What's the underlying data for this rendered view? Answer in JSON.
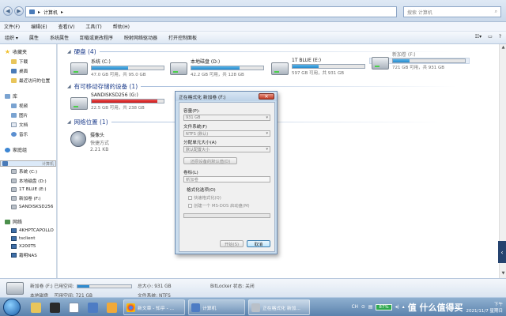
{
  "address": {
    "path": "计算机",
    "search_placeholder": "搜索 计算机"
  },
  "menu": {
    "items": [
      "文件(F)",
      "编辑(E)",
      "查看(V)",
      "工具(T)",
      "帮助(H)"
    ]
  },
  "commands": {
    "items": [
      "组织 ▾",
      "属性",
      "系统属性",
      "卸载或更改程序",
      "映射网络驱动器",
      "打开控制面板"
    ]
  },
  "nav": {
    "favorites": {
      "title": "收藏夹",
      "items": [
        "下载",
        "桌面",
        "最近访问的位置"
      ]
    },
    "library": {
      "title": "库",
      "items": [
        "视频",
        "图片",
        "文档",
        "音乐"
      ]
    },
    "homegroup": {
      "title": "家庭组"
    },
    "computer": {
      "title": "计算机",
      "items": [
        "系统 (C:)",
        "本地磁盘 (D:)",
        "1T BLUE (E:)",
        "新加卷 (F:)",
        "SANDISKSD256"
      ]
    },
    "network": {
      "title": "网络",
      "items": [
        "4KHPTCAPOLLO",
        "tsclient",
        "X200T5",
        "霜明NAS"
      ]
    }
  },
  "sections": {
    "harddisks": "硬盘 (4)",
    "removable": "有可移动存储的设备 (1)",
    "network": "网络位置 (1)"
  },
  "drives": [
    {
      "name": "系统 (C:)",
      "stat": "47.0 GB 可用，共 95.0 GB",
      "used": 0.51
    },
    {
      "name": "本地磁盘 (D:)",
      "stat": "42.2 GB 可用，共 128 GB",
      "used": 0.67
    },
    {
      "name": "1T BLUE (E:)",
      "stat": "597 GB 可用，共 931 GB",
      "used": 0.36
    },
    {
      "name": "新加卷 (F:)",
      "stat": "721 GB 可用，共 931 GB",
      "used": 0.23
    }
  ],
  "removable": {
    "name": "SANDISKSD256 (G:)",
    "stat": "22.5 GB 可用，共 238 GB",
    "used": 0.91
  },
  "netloc": {
    "name": "摄像头",
    "type": "快捷方式",
    "size": "2.21 KB"
  },
  "details": {
    "name": "新加卷 (F:)",
    "used_label": "已用空间:",
    "type": "本地磁盘",
    "free_label": "可用空间:",
    "free": "721 GB",
    "total_label": "总大小:",
    "total": "931 GB",
    "fs_label": "文件系统:",
    "fs": "NTFS",
    "bitlocker_label": "BitLocker 状态:",
    "bitlocker": "关闭",
    "used": 0.23
  },
  "dialog": {
    "title": "正在格式化 新加卷 (F:)",
    "capacity_label": "容量(P):",
    "capacity": "931 GB",
    "fs_label": "文件系统(F)",
    "fs": "NTFS (默认)",
    "alloc_label": "分配单元大小(A)",
    "alloc": "默认配置大小",
    "restore": "还原设备的默认值(D)",
    "volume_label": "卷标(L)",
    "volume": "新加卷",
    "opts_label": "格式化选项(O)",
    "quick": "快速格式化(Q)",
    "msdos": "创建一个 MS-DOS 启动盘(M)",
    "start": "开始(S)",
    "close": "取消"
  },
  "taskbar": {
    "btn_doc": "新文章 - 知乎 - ...",
    "btn_comp": "计算机",
    "btn_fmt": "正在格式化 新加...",
    "lang": "CH",
    "battery": "87%",
    "watermark": "值 什么值得买",
    "time": "下午",
    "date": "2021/11/7 星期日"
  }
}
